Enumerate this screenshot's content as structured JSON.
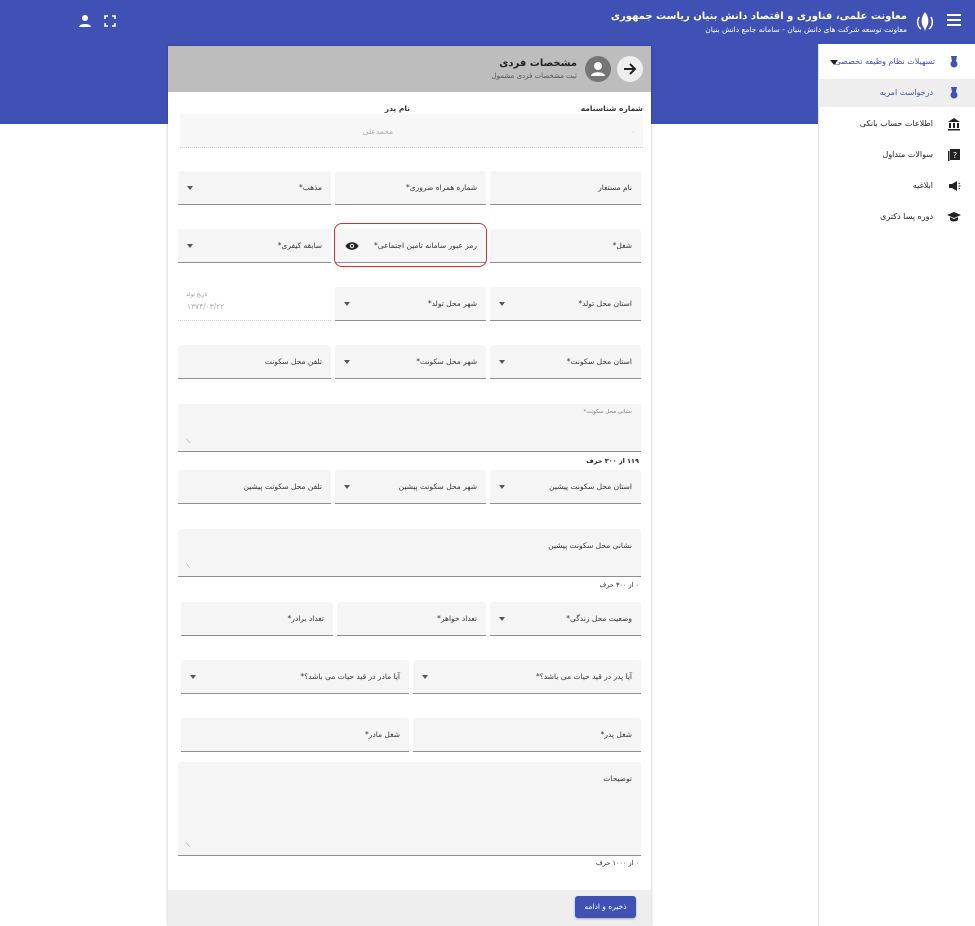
{
  "header": {
    "title": "معاونت علمی، فناوری و اقتصاد دانش بنیان ریاست جمهوری",
    "subtitle": "معاونت توسعه شرکت های دانش بنیان - سامانه جامع دانش بنیان"
  },
  "sidebar": {
    "parent_label": "تسهیلات نظام وظیفه تخصصی",
    "items": [
      {
        "label": "درخواست امریه",
        "icon": "medal-icon",
        "active": true
      },
      {
        "label": "اطلاعات حساب بانکی",
        "icon": "bank-icon"
      },
      {
        "label": "سوالات متداول",
        "icon": "question-book-icon"
      },
      {
        "label": "ابلاغیه",
        "icon": "megaphone-icon"
      },
      {
        "label": "دوره پسا دکتری",
        "icon": "graduation-cap-icon"
      }
    ]
  },
  "card": {
    "title": "مشخصات فردی",
    "subtitle": "ثبت مشخصات فردی مشمول"
  },
  "form": {
    "id_number_label": "شماره شناسنامه",
    "id_number_value": "۰",
    "father_name_label": "نام پدر",
    "father_name_value": "محمدعلی",
    "alias": "نام مستعار",
    "mobile": "شماره همراه ضروری*",
    "religion": "مذهب*",
    "job": "شغل*",
    "ssi_password": "رمز عبور سامانه تامین اجتماعی*",
    "criminal_record": "سابقه کیفری*",
    "birth_province": "استان محل تولد*",
    "birth_city": "شهر محل تولد*",
    "birth_date_label": "تاریخ تولد",
    "birth_date_value": "۱۳۷۴/۰۳/۲۲",
    "res_province": "استان محل سکونت*",
    "res_city": "شهر محل سکونت*",
    "res_phone": "تلفن محل سکونت",
    "res_address": "نشانی محل سکونت*",
    "res_address_counter": "۱۱۹ از ۳۰۰ حرف",
    "prev_province": "استان محل سکونت پیشین",
    "prev_city": "شهر محل سکونت پیشین",
    "prev_phone": "تلفن محل سکونت پیشین",
    "prev_address": "نشانی محل سکونت پیشین",
    "prev_address_counter": "۰ از ۳۰۰ حرف",
    "living_status": "وضعیت محل زندگی*",
    "sisters": "تعداد خواهر*",
    "brothers": "تعداد برادر*",
    "father_alive": "آیا پدر در قید حیات می باشد؟*",
    "mother_alive": "آیا مادر در قید حیات می باشد؟*",
    "father_job": "شغل پدر*",
    "mother_job": "شغل مادر*",
    "notes": "توضیحات",
    "notes_counter": "۰ از ۱۰۰۰ حرف"
  },
  "footer": {
    "save_label": "ذخیره و ادامه"
  },
  "colors": {
    "primary": "#3f51b5",
    "highlight": "#d32f2f"
  }
}
